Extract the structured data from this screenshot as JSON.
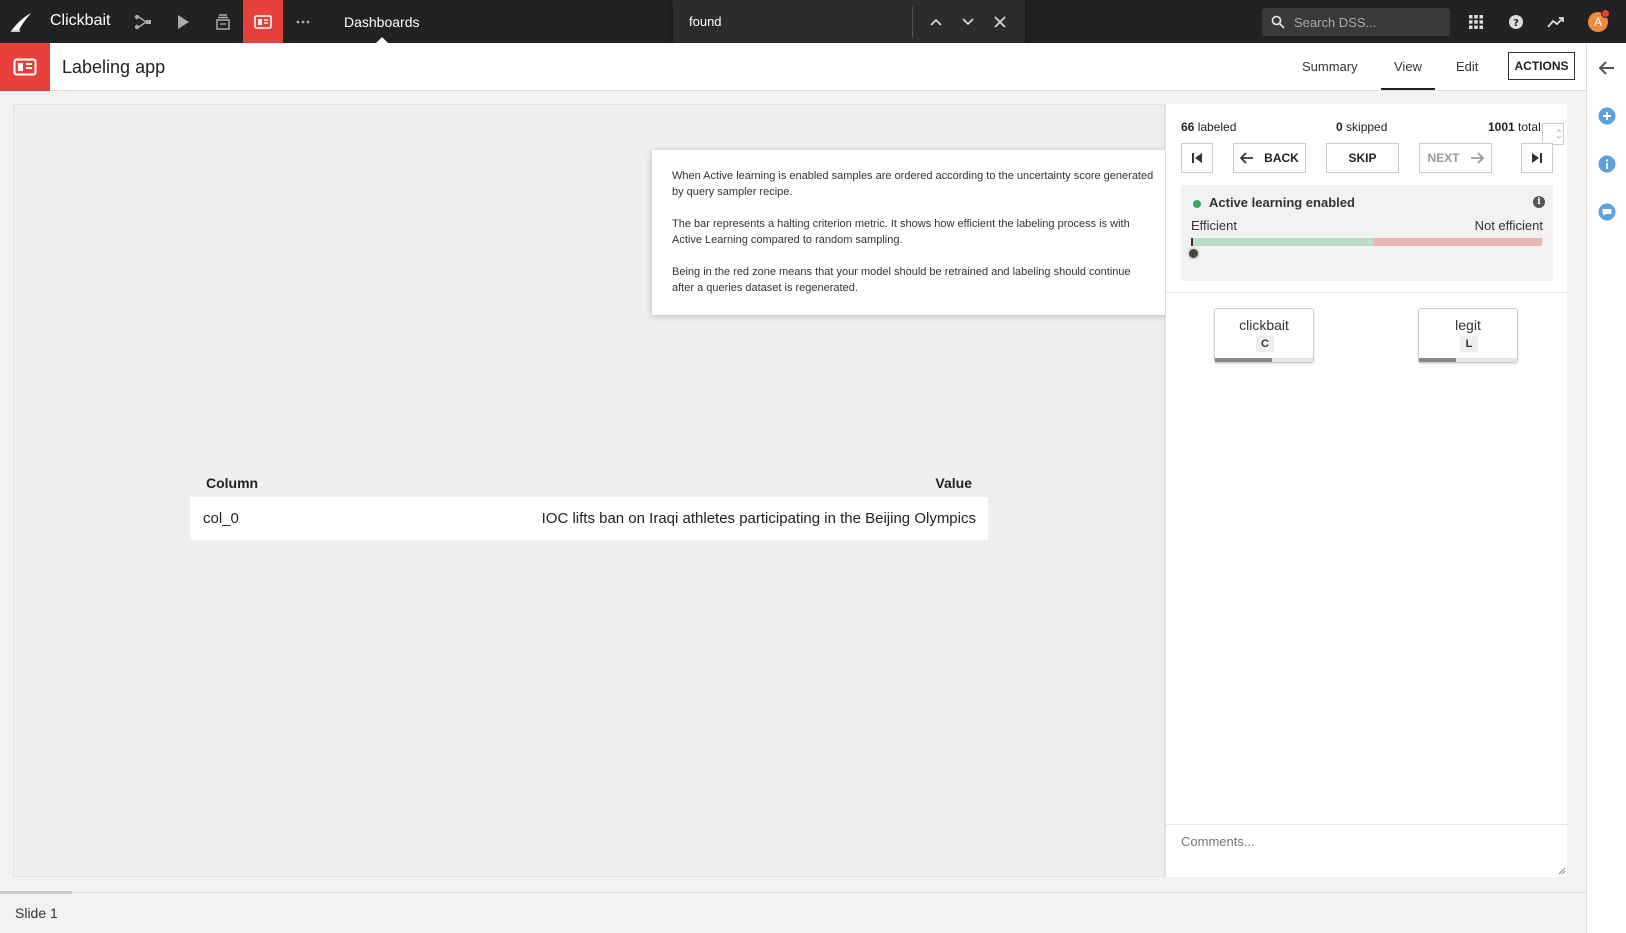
{
  "topnav": {
    "project": "Clickbait",
    "section": "Dashboards",
    "search_placeholder": "Search DSS...",
    "avatar_initial": "A",
    "accent": "#e8413c"
  },
  "findbar": {
    "query": "found"
  },
  "subheader": {
    "title": "Labeling app",
    "tabs": [
      "Summary",
      "View",
      "Edit"
    ],
    "active_tab": "View",
    "actions_label": "ACTIONS"
  },
  "canvas": {
    "table": {
      "headers": {
        "column": "Column",
        "value": "Value"
      },
      "rows": [
        {
          "column": "col_0",
          "value": "IOC lifts ban on Iraqi athletes participating in the Beijing Olympics"
        }
      ]
    },
    "tooltip": {
      "paragraphs": [
        "When Active learning is enabled samples are ordered according to the uncertainty score generated by query sampler recipe.",
        "The bar represents a halting criterion metric. It shows how efficient the labeling process is with Active Learning compared to random sampling.",
        "Being in the red zone means that your model should be retrained and labeling should continue after a queries dataset is regenerated."
      ]
    }
  },
  "panel": {
    "stats": {
      "labeled_count": "66",
      "labeled_label": "labeled",
      "skipped_count": "0",
      "skipped_label": "skipped",
      "total_count": "1001",
      "total_label": "total"
    },
    "nav": {
      "back": "BACK",
      "skip": "SKIP",
      "next": "NEXT"
    },
    "active_learning": {
      "title": "Active learning enabled",
      "efficient": "Efficient",
      "not_efficient": "Not efficient",
      "green_fraction": 0.52,
      "value_fraction": 0.0
    },
    "labels": [
      {
        "name": "clickbait",
        "key": "C",
        "progress": 0.58
      },
      {
        "name": "legit",
        "key": "L",
        "progress": 0.38
      }
    ],
    "comments_placeholder": "Comments..."
  },
  "footer": {
    "slide": "Slide 1"
  }
}
